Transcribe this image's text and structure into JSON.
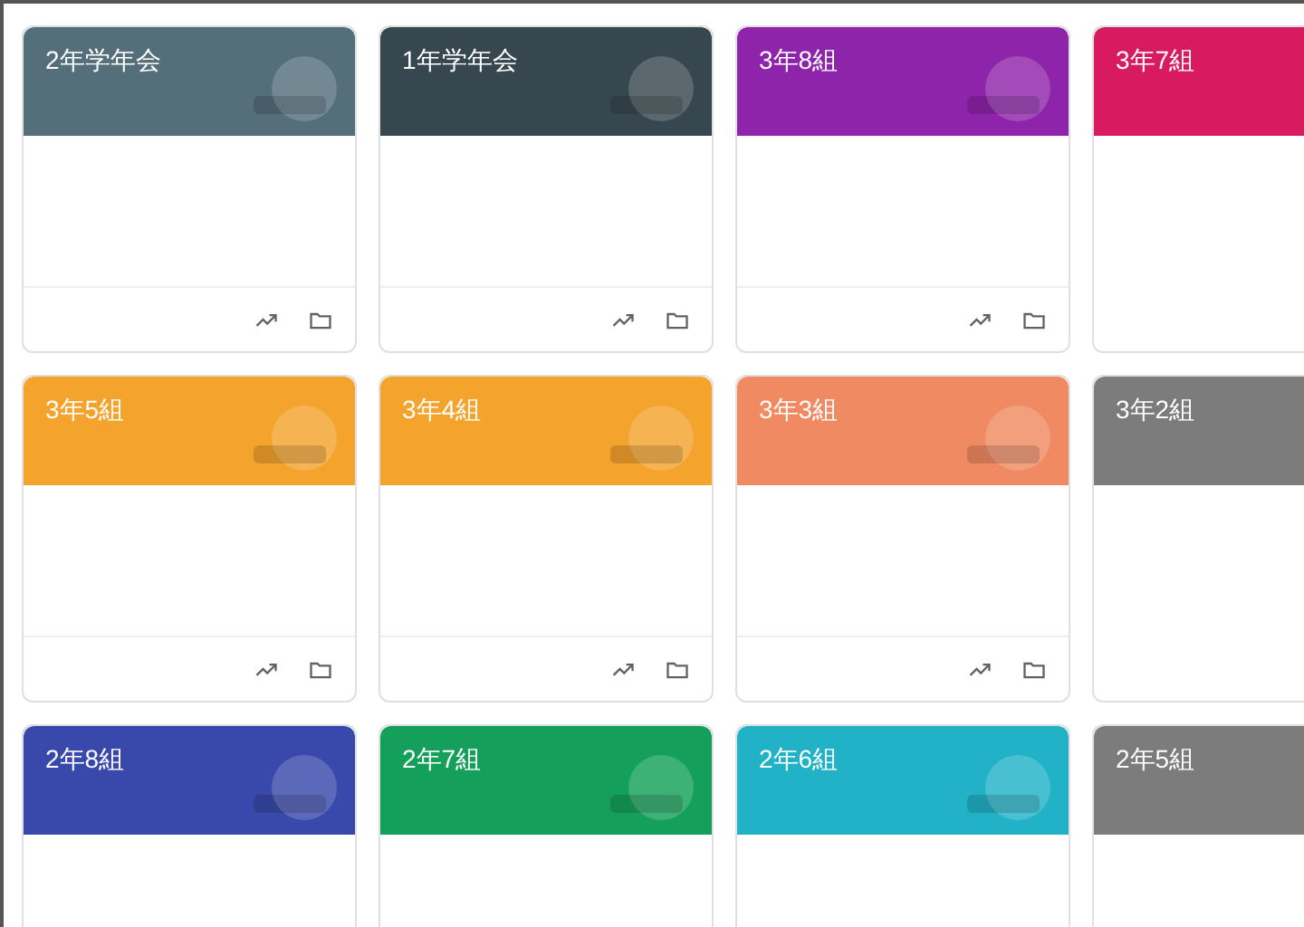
{
  "classes": [
    {
      "title": "2年学年会",
      "color": "#546e7a"
    },
    {
      "title": "1年学年会",
      "color": "#37474f"
    },
    {
      "title": "3年8組",
      "color": "#8e24aa"
    },
    {
      "title": "3年7組",
      "color": "#d81b60"
    },
    {
      "title": "3年5組",
      "color": "#f4a32c"
    },
    {
      "title": "3年4組",
      "color": "#f4a32c"
    },
    {
      "title": "3年3組",
      "color": "#ef8a62"
    },
    {
      "title": "3年2組",
      "color": "#7c7c7c"
    },
    {
      "title": "2年8組",
      "color": "#3949ab"
    },
    {
      "title": "2年7組",
      "color": "#14a05a"
    },
    {
      "title": "2年6組",
      "color": "#22b2c8"
    },
    {
      "title": "2年5組",
      "color": "#7c7c7c"
    }
  ]
}
